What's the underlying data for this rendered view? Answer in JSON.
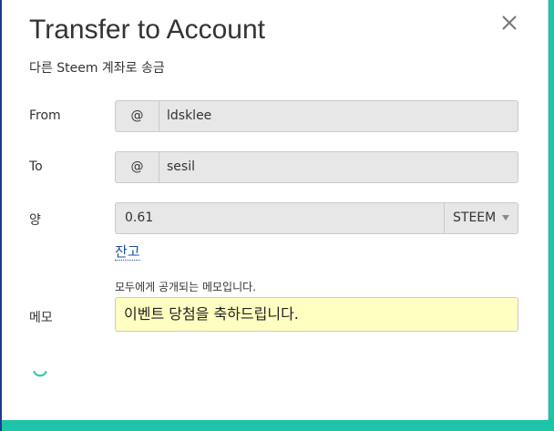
{
  "dialog": {
    "title": "Transfer to Account",
    "subtitle": "다른 Steem 계좌로 송금",
    "close_icon": "close-icon"
  },
  "form": {
    "from": {
      "label": "From",
      "prefix": "@",
      "value": "ldsklee"
    },
    "to": {
      "label": "To",
      "prefix": "@",
      "value": "sesil"
    },
    "amount": {
      "label": "양",
      "value": "0.61",
      "currency": "STEEM",
      "balance_link": "잔고"
    },
    "memo": {
      "label": "메모",
      "hint": "모두에게 공개되는 메모입니다.",
      "value": "이벤트 당첨을 축하드립니다."
    },
    "loading": "loading-spinner-icon"
  },
  "colors": {
    "accent": "#1dc4a8",
    "link": "#1a5099",
    "memo_background": "#ffffc2",
    "field_background": "#e7e7e7"
  }
}
